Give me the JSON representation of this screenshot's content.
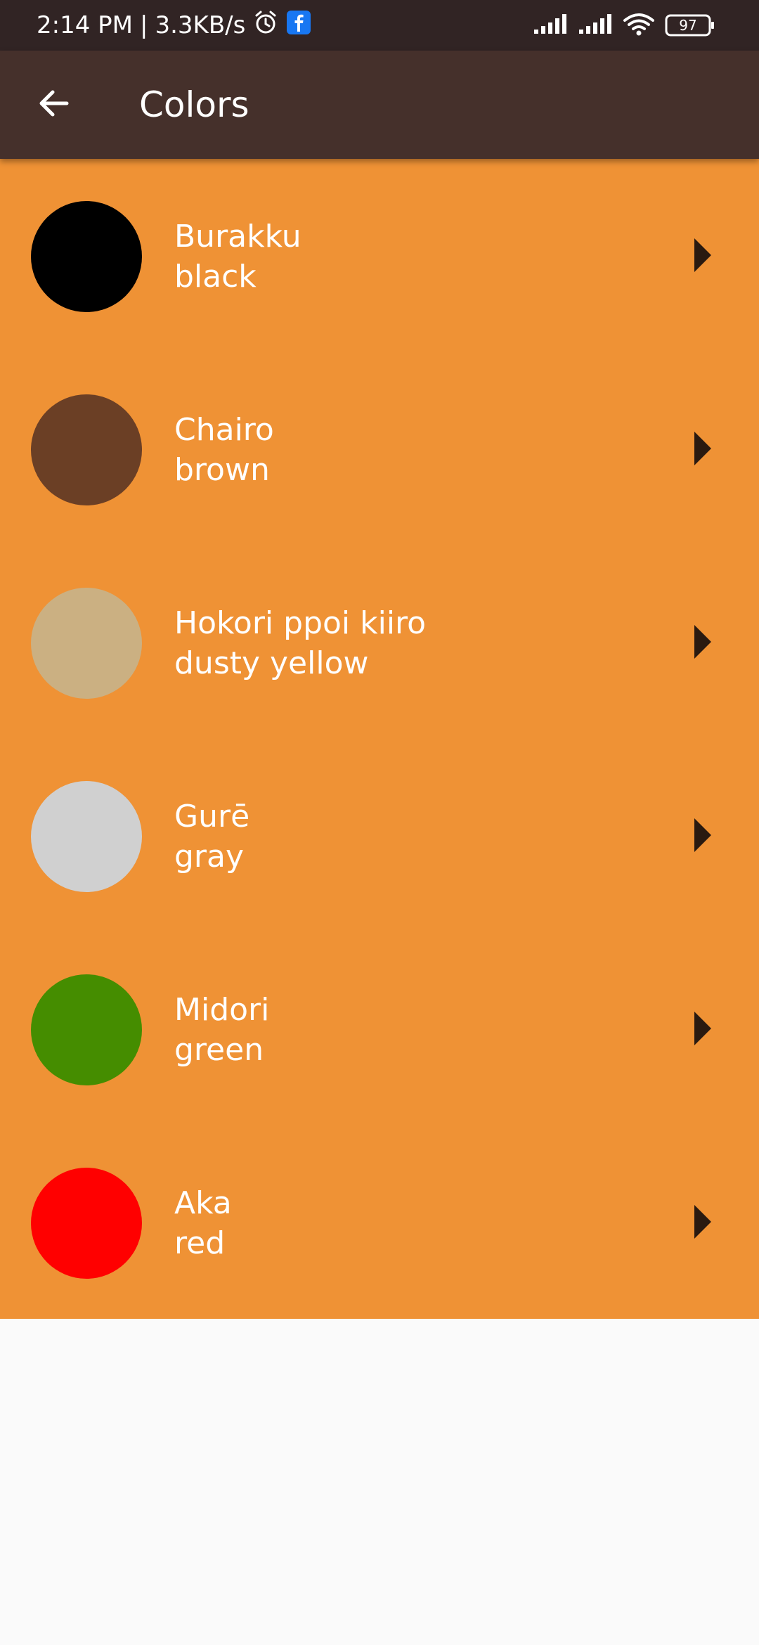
{
  "status_bar": {
    "time": "2:14 PM",
    "separator": "|",
    "speed": "3.3KB/s",
    "battery": "97",
    "icons": [
      "alarm-icon",
      "facebook-icon",
      "signal-icon",
      "signal-icon",
      "wifi-icon",
      "battery-icon"
    ]
  },
  "app_bar": {
    "title": "Colors",
    "back_icon": "arrow-left-icon"
  },
  "colors": {
    "list_background": "#EF9235",
    "app_bar": "#45302B",
    "status_bar": "#312424"
  },
  "items": [
    {
      "japanese": "Burakku",
      "english": "black",
      "swatch": "#000000",
      "icon": "play-arrow-icon"
    },
    {
      "japanese": "Chairo",
      "english": "brown",
      "swatch": "#6B3F25",
      "icon": "play-arrow-icon"
    },
    {
      "japanese": "Hokori ppoi kiiro",
      "english": "dusty yellow",
      "swatch": "#CBB082",
      "icon": "play-arrow-icon"
    },
    {
      "japanese": "Gurē",
      "english": "gray",
      "swatch": "#D0D0D0",
      "icon": "play-arrow-icon"
    },
    {
      "japanese": "Midori",
      "english": "green",
      "swatch": "#458D00",
      "icon": "play-arrow-icon"
    },
    {
      "japanese": "Aka",
      "english": "red",
      "swatch": "#FF0000",
      "icon": "play-arrow-icon"
    }
  ]
}
